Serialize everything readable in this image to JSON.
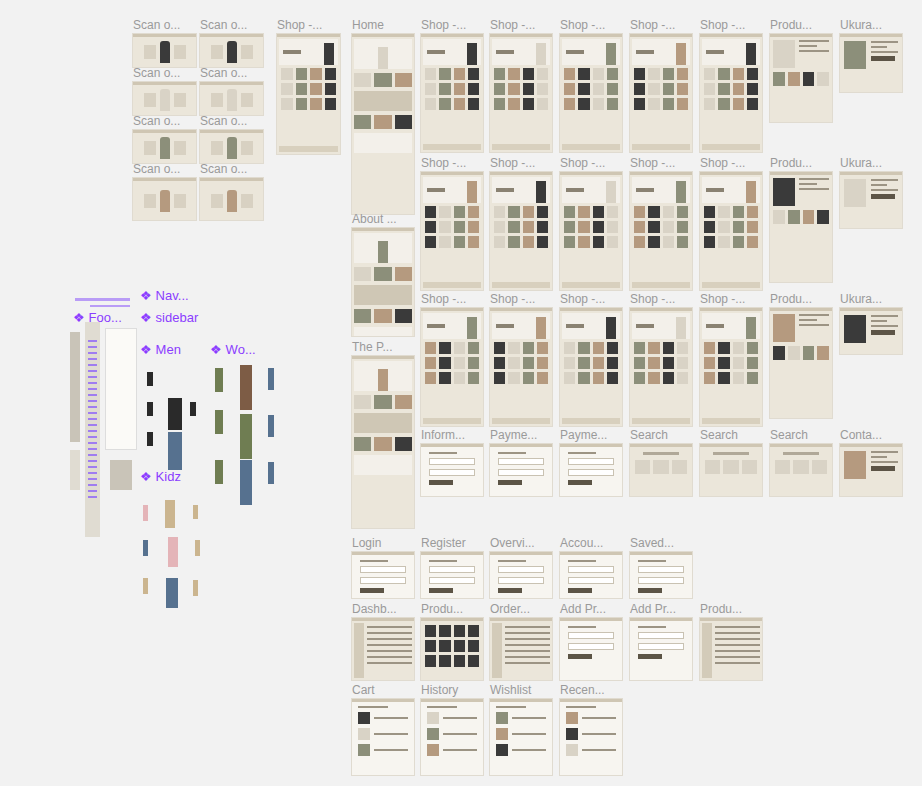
{
  "frames": [
    {
      "label": "Scan o...",
      "kind": "scan"
    },
    {
      "label": "Scan o...",
      "kind": "scan"
    },
    {
      "label": "Scan o...",
      "kind": "scan"
    },
    {
      "label": "Scan o...",
      "kind": "scan"
    },
    {
      "label": "Scan o...",
      "kind": "scan"
    },
    {
      "label": "Scan o...",
      "kind": "scan"
    },
    {
      "label": "Scan o...",
      "kind": "scan"
    },
    {
      "label": "Scan o...",
      "kind": "scan"
    },
    {
      "label": "Shop -...",
      "kind": "shop"
    },
    {
      "label": "Home",
      "kind": "page"
    },
    {
      "label": "About ...",
      "kind": "page"
    },
    {
      "label": "The P...",
      "kind": "page"
    },
    {
      "label": "Shop -...",
      "kind": "shop"
    },
    {
      "label": "Shop -...",
      "kind": "shop"
    },
    {
      "label": "Shop -...",
      "kind": "shop"
    },
    {
      "label": "Shop -...",
      "kind": "shop"
    },
    {
      "label": "Shop -...",
      "kind": "shop"
    },
    {
      "label": "Produ...",
      "kind": "product"
    },
    {
      "label": "Ukura...",
      "kind": "detail"
    },
    {
      "label": "Shop -...",
      "kind": "shop"
    },
    {
      "label": "Shop -...",
      "kind": "shop"
    },
    {
      "label": "Shop -...",
      "kind": "shop"
    },
    {
      "label": "Shop -...",
      "kind": "shop"
    },
    {
      "label": "Shop -...",
      "kind": "shop"
    },
    {
      "label": "Produ...",
      "kind": "product"
    },
    {
      "label": "Ukura...",
      "kind": "detail"
    },
    {
      "label": "Shop -...",
      "kind": "shop"
    },
    {
      "label": "Shop -...",
      "kind": "shop"
    },
    {
      "label": "Shop -...",
      "kind": "shop"
    },
    {
      "label": "Shop -...",
      "kind": "shop"
    },
    {
      "label": "Shop -...",
      "kind": "shop"
    },
    {
      "label": "Produ...",
      "kind": "product"
    },
    {
      "label": "Ukura...",
      "kind": "detail"
    },
    {
      "label": "Inform...",
      "kind": "form"
    },
    {
      "label": "Payme...",
      "kind": "form"
    },
    {
      "label": "Payme...",
      "kind": "form"
    },
    {
      "label": "Search",
      "kind": "search"
    },
    {
      "label": "Search",
      "kind": "search"
    },
    {
      "label": "Search",
      "kind": "search"
    },
    {
      "label": "Conta...",
      "kind": "detail"
    },
    {
      "label": "Login",
      "kind": "form"
    },
    {
      "label": "Register",
      "kind": "form"
    },
    {
      "label": "Overvi...",
      "kind": "form"
    },
    {
      "label": "Accou...",
      "kind": "form"
    },
    {
      "label": "Saved...",
      "kind": "form"
    },
    {
      "label": "Dashb...",
      "kind": "dash"
    },
    {
      "label": "Produ...",
      "kind": "grid"
    },
    {
      "label": "Order...",
      "kind": "dash"
    },
    {
      "label": "Add Pr...",
      "kind": "form"
    },
    {
      "label": "Add Pr...",
      "kind": "form"
    },
    {
      "label": "Produ...",
      "kind": "dash"
    },
    {
      "label": "Cart",
      "kind": "list"
    },
    {
      "label": "History",
      "kind": "list"
    },
    {
      "label": "Wishlist",
      "kind": "list"
    },
    {
      "label": "Recen...",
      "kind": "list"
    }
  ],
  "components": [
    {
      "label": "❖ Nav..."
    },
    {
      "label": "❖ Foo..."
    },
    {
      "label": "❖ sidebar"
    },
    {
      "label": "❖ Men"
    },
    {
      "label": "❖ Wo..."
    },
    {
      "label": "❖ Kidz"
    }
  ]
}
